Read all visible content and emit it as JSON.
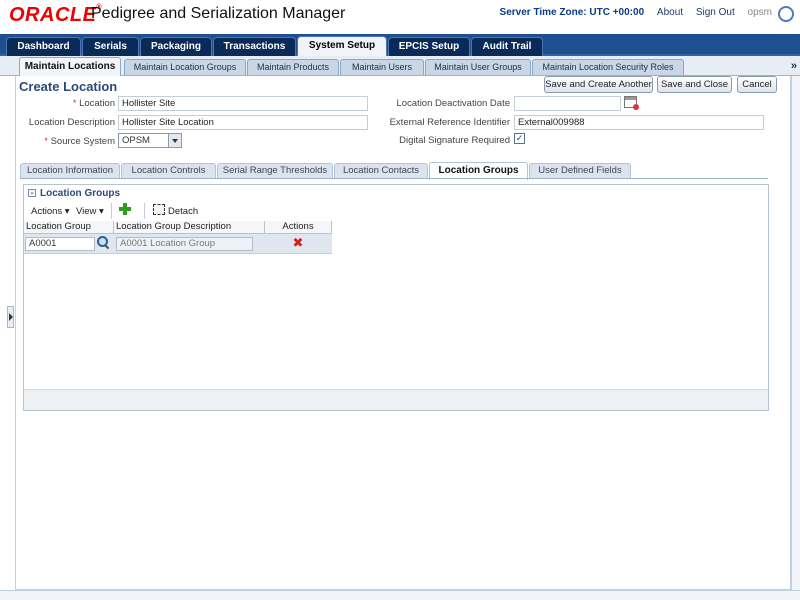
{
  "header": {
    "logo": "ORACLE",
    "title": "Pedigree and Serialization Manager",
    "server_time": "Server Time Zone: UTC +00:00",
    "about": "About",
    "sign_out": "Sign Out",
    "user": "opsm"
  },
  "main_tabs": [
    "Dashboard",
    "Serials",
    "Packaging",
    "Transactions",
    "System Setup",
    "EPCIS Setup",
    "Audit Trail"
  ],
  "main_tab_active": "System Setup",
  "sub_tabs": [
    "Maintain Locations",
    "Maintain Location Groups",
    "Maintain Products",
    "Maintain Users",
    "Maintain User Groups",
    "Maintain Location Security Roles"
  ],
  "sub_tab_active": "Maintain Locations",
  "page": {
    "title": "Create Location",
    "buttons": {
      "save_create_another": "Save and Create Another",
      "save_close": "Save and Close",
      "cancel": "Cancel"
    }
  },
  "form": {
    "location_label": "Location",
    "location_value": "Hollister Site",
    "description_label": "Location Description",
    "description_value": "Hollister Site Location",
    "source_label": "Source System",
    "source_value": "OPSM",
    "deactivation_label": "Location Deactivation Date",
    "deactivation_value": "",
    "ext_ref_label": "External Reference Identifier",
    "ext_ref_value": "External009988",
    "digital_sig_label": "Digital Signature Required",
    "digital_sig_checked": true,
    "required_marker": "*"
  },
  "detail_tabs": [
    "Location Information",
    "Location Controls",
    "Serial Range Thresholds",
    "Location Contacts",
    "Location Groups",
    "User Defined Fields"
  ],
  "detail_tab_active": "Location Groups",
  "location_groups": {
    "header": "Location Groups",
    "toolbar": {
      "actions": "Actions",
      "view": "View",
      "detach": "Detach"
    },
    "columns": [
      "Location Group",
      "Location Group Description",
      "Actions"
    ],
    "rows": [
      {
        "group": "A0001",
        "description": "A0001 Location Group"
      }
    ]
  },
  "colors": {
    "brand_red": "#ee0000",
    "tab_bar": "#1f4f8e",
    "title_blue": "#2a4a7a"
  }
}
